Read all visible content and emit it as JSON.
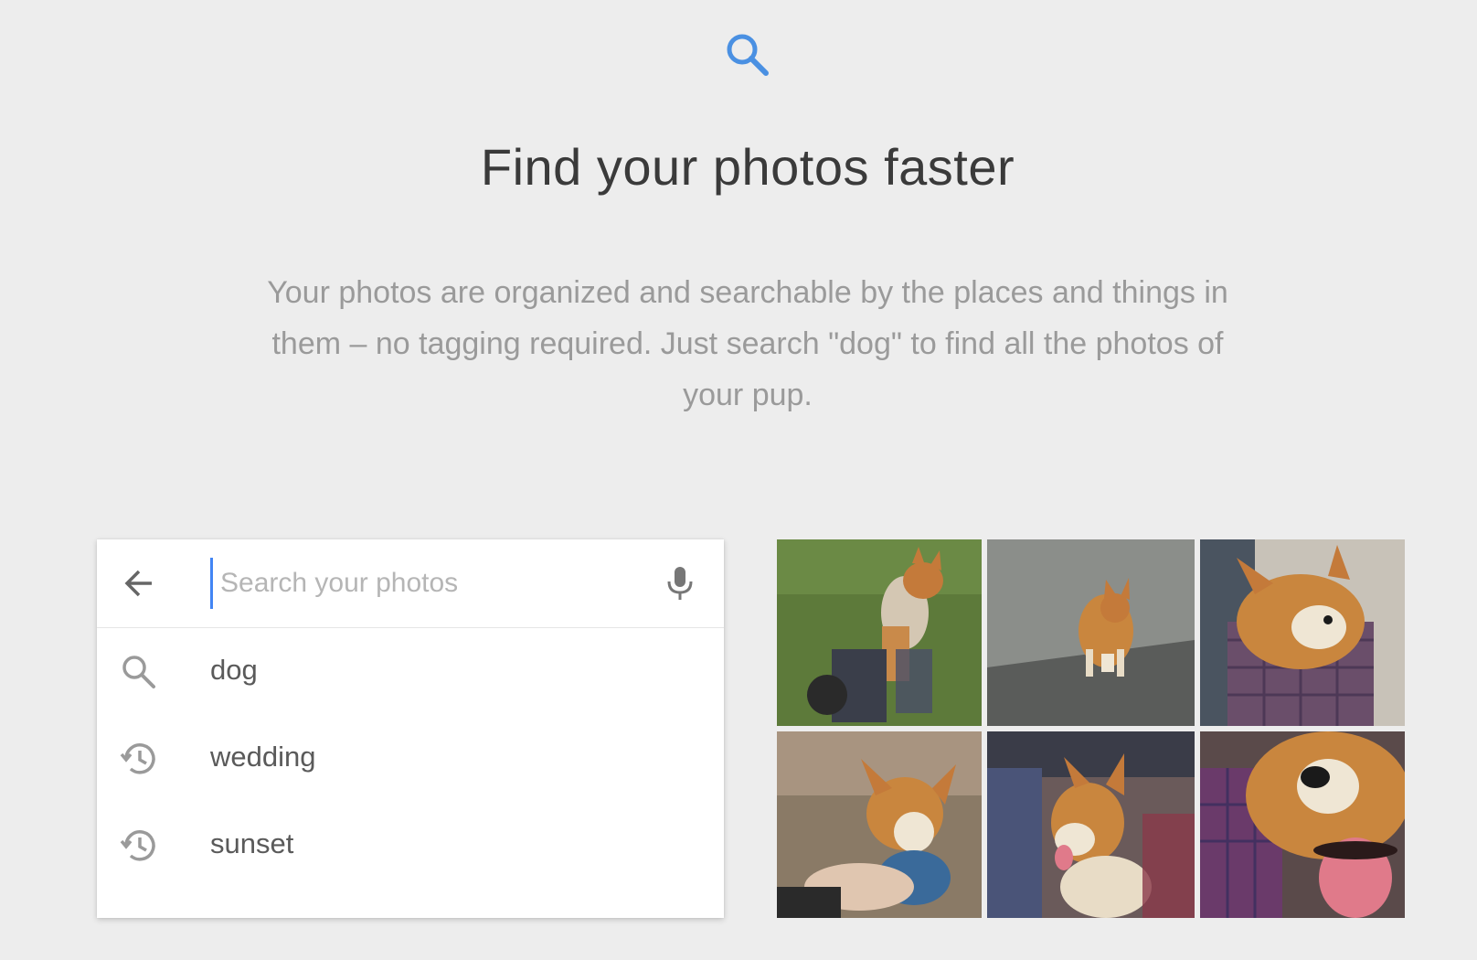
{
  "hero": {
    "icon": "search-icon",
    "accent_color": "#4a90e2",
    "title": "Find your photos faster",
    "description": "Your photos are organized and searchable by the places and things in them – no tagging required. Just search \"dog\" to find all the photos of your pup."
  },
  "search": {
    "back_icon": "arrow-back-icon",
    "placeholder": "Search your photos",
    "value": "",
    "mic_icon": "microphone-icon",
    "suggestions": [
      {
        "icon": "search-icon",
        "label": "dog"
      },
      {
        "icon": "history-icon",
        "label": "wedding"
      },
      {
        "icon": "history-icon",
        "label": "sunset"
      }
    ]
  },
  "photos": [
    {
      "subject": "corgi-jumping-on-grass"
    },
    {
      "subject": "corgi-on-pavement"
    },
    {
      "subject": "corgi-held-in-plaid-shirt"
    },
    {
      "subject": "corgi-playing-with-toy"
    },
    {
      "subject": "corgi-on-lap"
    },
    {
      "subject": "corgi-closeup-tongue"
    }
  ]
}
